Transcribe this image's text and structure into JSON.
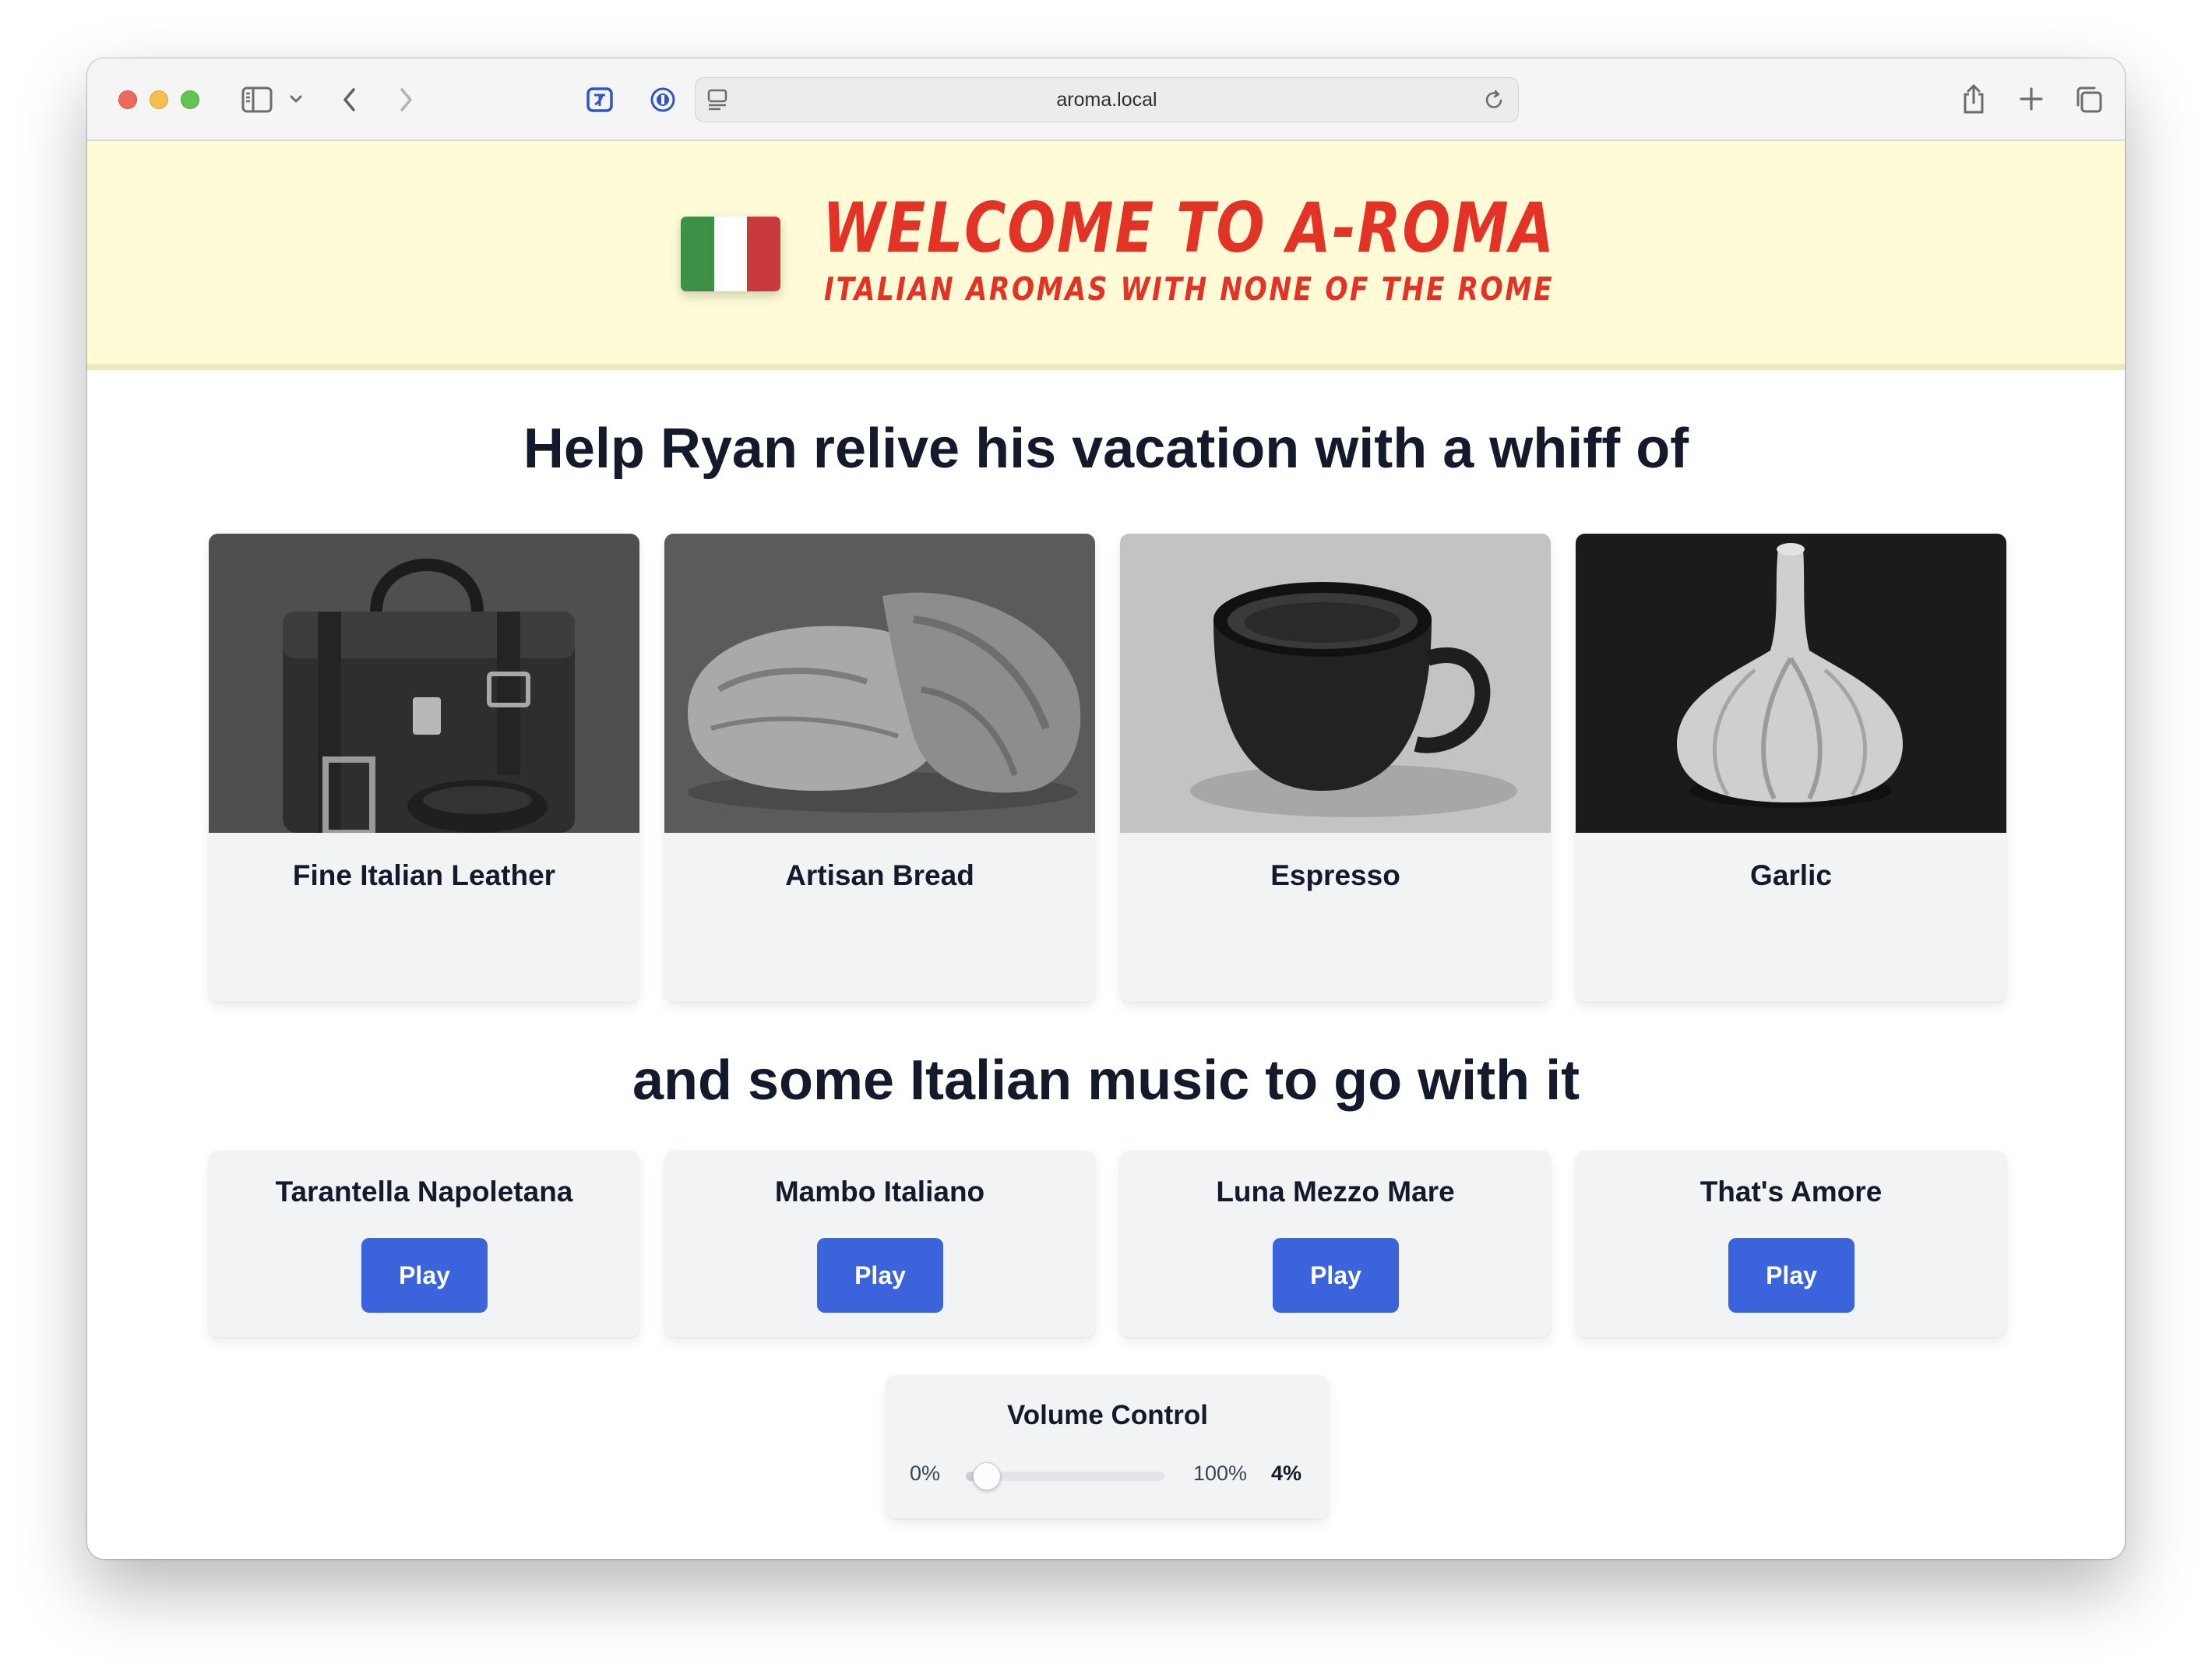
{
  "browser": {
    "url": "aroma.local",
    "icons": [
      "sidebar-icon",
      "chevron-down-icon",
      "back-icon",
      "forward-icon",
      "translate-extension-icon",
      "password-extension-icon",
      "page-menu-icon",
      "reload-icon",
      "share-icon",
      "new-tab-icon",
      "tab-overview-icon"
    ]
  },
  "hero": {
    "title": "WELCOME TO A-ROMA",
    "subtitle": "ITALIAN AROMAS WITH NONE OF THE ROME",
    "flag_colors": [
      "#3d9046",
      "#ffffff",
      "#c93a3c"
    ],
    "accent": "#e33326",
    "background": "#fefbd6"
  },
  "aroma_section": {
    "heading": "Help Ryan relive his vacation with a whiff of",
    "items": [
      {
        "label": "Fine Italian Leather",
        "image": "leather-bag-image"
      },
      {
        "label": "Artisan Bread",
        "image": "bread-loaf-image"
      },
      {
        "label": "Espresso",
        "image": "espresso-cup-image"
      },
      {
        "label": "Garlic",
        "image": "garlic-bulb-image"
      }
    ]
  },
  "music_section": {
    "heading": "and some Italian music to go with it",
    "songs": [
      {
        "title": "Tarantella Napoletana",
        "button": "Play"
      },
      {
        "title": "Mambo Italiano",
        "button": "Play"
      },
      {
        "title": "Luna Mezzo Mare",
        "button": "Play"
      },
      {
        "title": "That's Amore",
        "button": "Play"
      }
    ],
    "button_color": "#3a63dc"
  },
  "volume": {
    "title": "Volume Control",
    "min_label": "0%",
    "max_label": "100%",
    "value_label": "4%",
    "value_fraction": 0.04
  }
}
